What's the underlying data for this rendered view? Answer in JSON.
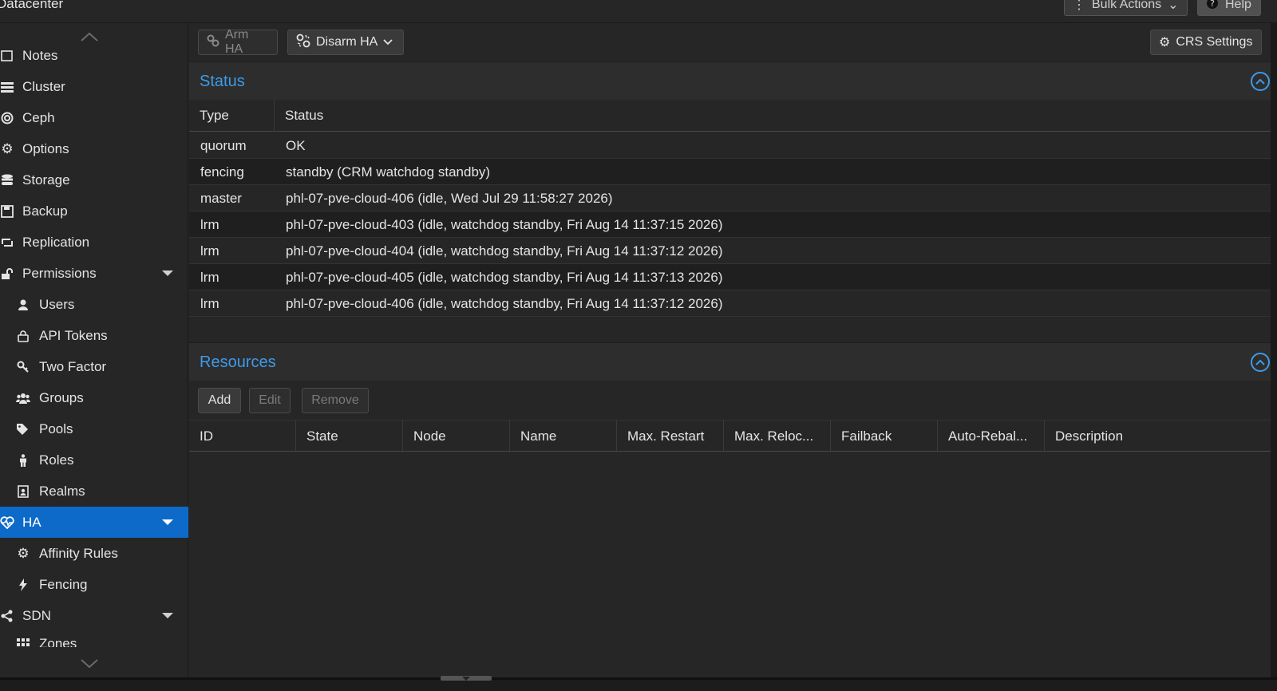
{
  "header": {
    "breadcrumb": "Datacenter",
    "bulk_actions_label": "Bulk Actions",
    "help_label": "Help"
  },
  "sidebar": {
    "items": [
      {
        "label": "Notes",
        "icon": "notes-icon"
      },
      {
        "label": "Cluster",
        "icon": "cluster-icon"
      },
      {
        "label": "Ceph",
        "icon": "ceph-icon"
      },
      {
        "label": "Options",
        "icon": "gear-icon"
      },
      {
        "label": "Storage",
        "icon": "database-icon"
      },
      {
        "label": "Backup",
        "icon": "floppy-icon"
      },
      {
        "label": "Replication",
        "icon": "replication-icon"
      },
      {
        "label": "Permissions",
        "icon": "unlock-icon",
        "expandable": true
      },
      {
        "label": "Users",
        "icon": "user-icon",
        "sub": true
      },
      {
        "label": "API Tokens",
        "icon": "lock-icon",
        "sub": true
      },
      {
        "label": "Two Factor",
        "icon": "key-icon",
        "sub": true
      },
      {
        "label": "Groups",
        "icon": "users-icon",
        "sub": true
      },
      {
        "label": "Pools",
        "icon": "tags-icon",
        "sub": true
      },
      {
        "label": "Roles",
        "icon": "male-icon",
        "sub": true
      },
      {
        "label": "Realms",
        "icon": "id-badge-icon",
        "sub": true
      },
      {
        "label": "HA",
        "icon": "heartbeat-icon",
        "expandable": true,
        "active": true
      },
      {
        "label": "Affinity Rules",
        "icon": "gears-icon",
        "sub": true
      },
      {
        "label": "Fencing",
        "icon": "bolt-icon",
        "sub": true
      },
      {
        "label": "SDN",
        "icon": "sdn-icon",
        "expandable": true
      },
      {
        "label": "Zones",
        "icon": "grid-icon",
        "sub": true
      }
    ]
  },
  "toolbar": {
    "arm_label": "Arm HA",
    "disarm_label": "Disarm HA",
    "crs_label": "CRS Settings"
  },
  "status": {
    "title": "Status",
    "columns": [
      "Type",
      "Status"
    ],
    "rows": [
      {
        "type": "quorum",
        "status": "OK"
      },
      {
        "type": "fencing",
        "status": "standby (CRM watchdog standby)"
      },
      {
        "type": "master",
        "status": "phl-07-pve-cloud-406 (idle, Wed Jul 29 11:58:27 2026)"
      },
      {
        "type": "lrm",
        "status": "phl-07-pve-cloud-403 (idle, watchdog standby, Fri Aug 14 11:37:15 2026)"
      },
      {
        "type": "lrm",
        "status": "phl-07-pve-cloud-404 (idle, watchdog standby, Fri Aug 14 11:37:12 2026)"
      },
      {
        "type": "lrm",
        "status": "phl-07-pve-cloud-405 (idle, watchdog standby, Fri Aug 14 11:37:13 2026)"
      },
      {
        "type": "lrm",
        "status": "phl-07-pve-cloud-406 (idle, watchdog standby, Fri Aug 14 11:37:12 2026)"
      }
    ]
  },
  "resources": {
    "title": "Resources",
    "add_label": "Add",
    "edit_label": "Edit",
    "remove_label": "Remove",
    "columns": [
      "ID",
      "State",
      "Node",
      "Name",
      "Max. Restart",
      "Max. Reloc...",
      "Failback",
      "Auto-Rebal...",
      "Description"
    ]
  },
  "colors": {
    "accent": "#3d9be9",
    "active_nav": "#0d6ac8",
    "background": "#262626"
  }
}
